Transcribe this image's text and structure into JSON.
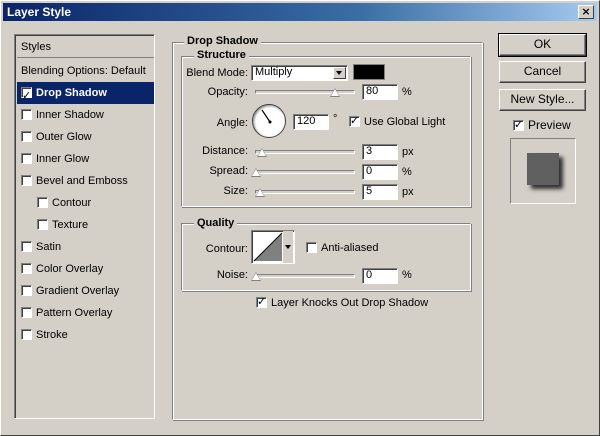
{
  "window": {
    "title": "Layer Style"
  },
  "styles_list": {
    "header": "Styles",
    "blending": "Blending Options: Default",
    "items": [
      {
        "label": "Drop Shadow",
        "checked": true,
        "selected": true,
        "indent": false
      },
      {
        "label": "Inner Shadow",
        "checked": false,
        "selected": false,
        "indent": false
      },
      {
        "label": "Outer Glow",
        "checked": false,
        "selected": false,
        "indent": false
      },
      {
        "label": "Inner Glow",
        "checked": false,
        "selected": false,
        "indent": false
      },
      {
        "label": "Bevel and Emboss",
        "checked": false,
        "selected": false,
        "indent": false
      },
      {
        "label": "Contour",
        "checked": false,
        "selected": false,
        "indent": true
      },
      {
        "label": "Texture",
        "checked": false,
        "selected": false,
        "indent": true
      },
      {
        "label": "Satin",
        "checked": false,
        "selected": false,
        "indent": false
      },
      {
        "label": "Color Overlay",
        "checked": false,
        "selected": false,
        "indent": false
      },
      {
        "label": "Gradient Overlay",
        "checked": false,
        "selected": false,
        "indent": false
      },
      {
        "label": "Pattern Overlay",
        "checked": false,
        "selected": false,
        "indent": false
      },
      {
        "label": "Stroke",
        "checked": false,
        "selected": false,
        "indent": false
      }
    ]
  },
  "drop_shadow": {
    "title": "Drop Shadow",
    "structure": {
      "title": "Structure",
      "blend_mode_label": "Blend Mode:",
      "blend_mode_value": "Multiply",
      "shadow_color": "#000000",
      "opacity_label": "Opacity:",
      "opacity_value": "80",
      "opacity_unit": "%",
      "opacity_fraction": 0.8,
      "angle_label": "Angle:",
      "angle_value": "120",
      "angle_unit": "°",
      "use_global_light_label": "Use Global Light",
      "use_global_light_checked": true,
      "distance_label": "Distance:",
      "distance_value": "3",
      "distance_unit": "px",
      "spread_label": "Spread:",
      "spread_value": "0",
      "spread_unit": "%",
      "size_label": "Size:",
      "size_value": "5",
      "size_unit": "px"
    },
    "quality": {
      "title": "Quality",
      "contour_label": "Contour:",
      "anti_aliased_label": "Anti-aliased",
      "anti_aliased_checked": false,
      "noise_label": "Noise:",
      "noise_value": "0",
      "noise_unit": "%"
    },
    "knockout_label": "Layer Knocks Out Drop Shadow",
    "knockout_checked": true
  },
  "actions": {
    "ok": "OK",
    "cancel": "Cancel",
    "new_style": "New Style...",
    "preview_label": "Preview",
    "preview_checked": true
  }
}
